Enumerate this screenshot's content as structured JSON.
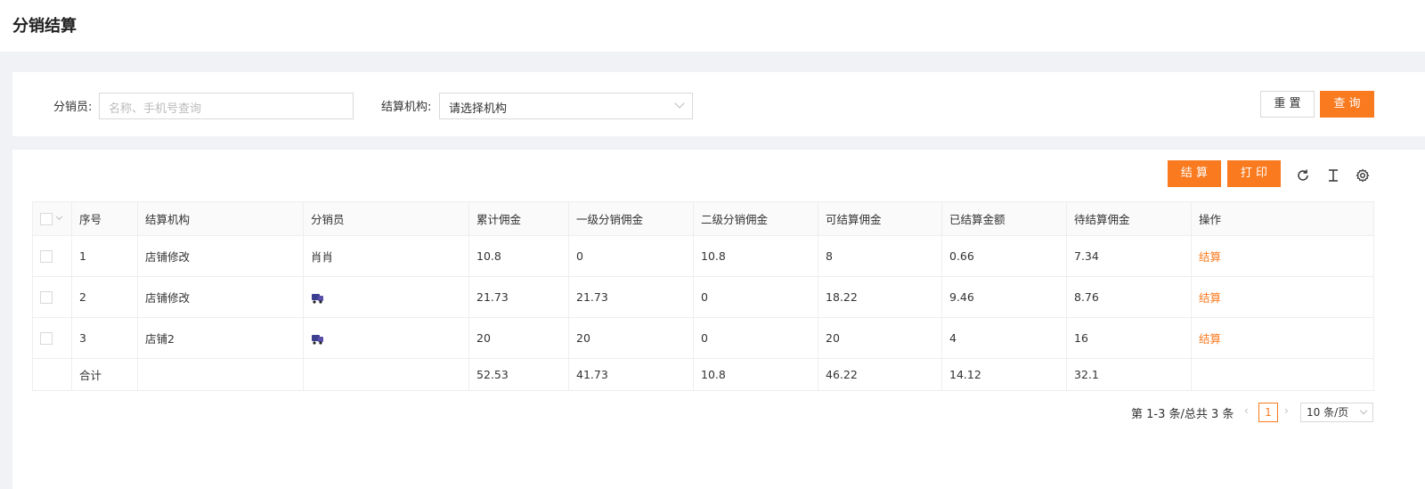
{
  "header": {
    "title": "分销结算"
  },
  "search": {
    "distributor_label": "分销员:",
    "distributor_placeholder": "名称、手机号查询",
    "org_label": "结算机构:",
    "org_placeholder": "请选择机构",
    "reset_label": "重 置",
    "query_label": "查 询"
  },
  "toolbar": {
    "settle_label": "结 算",
    "print_label": "打 印",
    "icons": [
      "refresh-icon",
      "column-height-icon",
      "settings-icon"
    ]
  },
  "table": {
    "columns": [
      "序号",
      "结算机构",
      "分销员",
      "累计佣金",
      "一级分销佣金",
      "二级分销佣金",
      "可结算佣金",
      "已结算金额",
      "待结算佣金",
      "操作"
    ],
    "rows": [
      {
        "index": "1",
        "org": "店铺修改",
        "distributor": "肖肖",
        "distributor_avatar": false,
        "total": "10.8",
        "level1": "0",
        "level2": "10.8",
        "settleable": "8",
        "settled": "0.66",
        "pending": "7.34",
        "action": "结算"
      },
      {
        "index": "2",
        "org": "店铺修改",
        "distributor": "",
        "distributor_avatar": true,
        "total": "21.73",
        "level1": "21.73",
        "level2": "0",
        "settleable": "18.22",
        "settled": "9.46",
        "pending": "8.76",
        "action": "结算"
      },
      {
        "index": "3",
        "org": "店铺2",
        "distributor": "",
        "distributor_avatar": true,
        "total": "20",
        "level1": "20",
        "level2": "0",
        "settleable": "20",
        "settled": "4",
        "pending": "16",
        "action": "结算"
      }
    ],
    "summary": {
      "label": "合计",
      "total": "52.53",
      "level1": "41.73",
      "level2": "10.8",
      "settleable": "46.22",
      "settled": "14.12",
      "pending": "32.1"
    }
  },
  "pagination": {
    "info": "第 1-3 条/总共 3 条",
    "current_page": "1",
    "prev": "‹",
    "next": "›",
    "page_size": "10 条/页"
  },
  "colors": {
    "accent": "#f97a1f",
    "background": "#f0f2f5"
  }
}
